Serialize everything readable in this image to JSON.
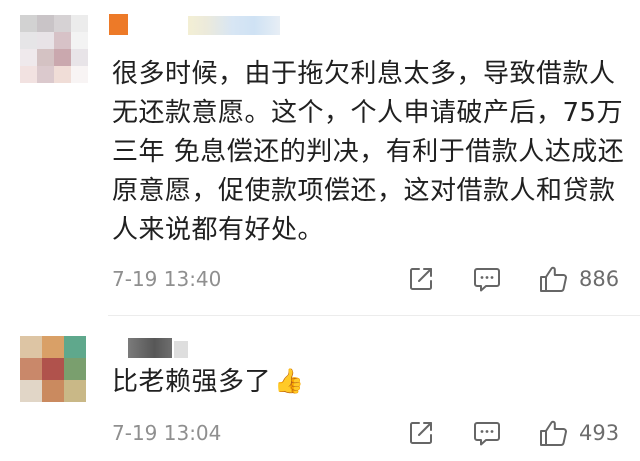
{
  "comments": [
    {
      "text_lines": [
        "很多时候，由于拖欠利息太多，导致借款人",
        "无还款意愿。这个，个人申请破产后，75万",
        "三年 免息偿还的判决，有利于借款人达成还",
        "原意愿，促使款项偿还，这对借款人和贷款",
        "人来说都有好处。"
      ],
      "time": "7-19 13:40",
      "likes": "886"
    },
    {
      "text": "比老赖强多了",
      "emoji": "thumbs-up-emoji",
      "time": "7-19 13:04",
      "likes": "493"
    }
  ],
  "icons": {
    "share": "share-icon",
    "reply": "comment-icon",
    "like": "thumbs-up-icon"
  },
  "colors": {
    "text": "#202020",
    "meta": "#8f8f8f",
    "icon": "#666666",
    "username_1_accent": "#ed7a28"
  }
}
